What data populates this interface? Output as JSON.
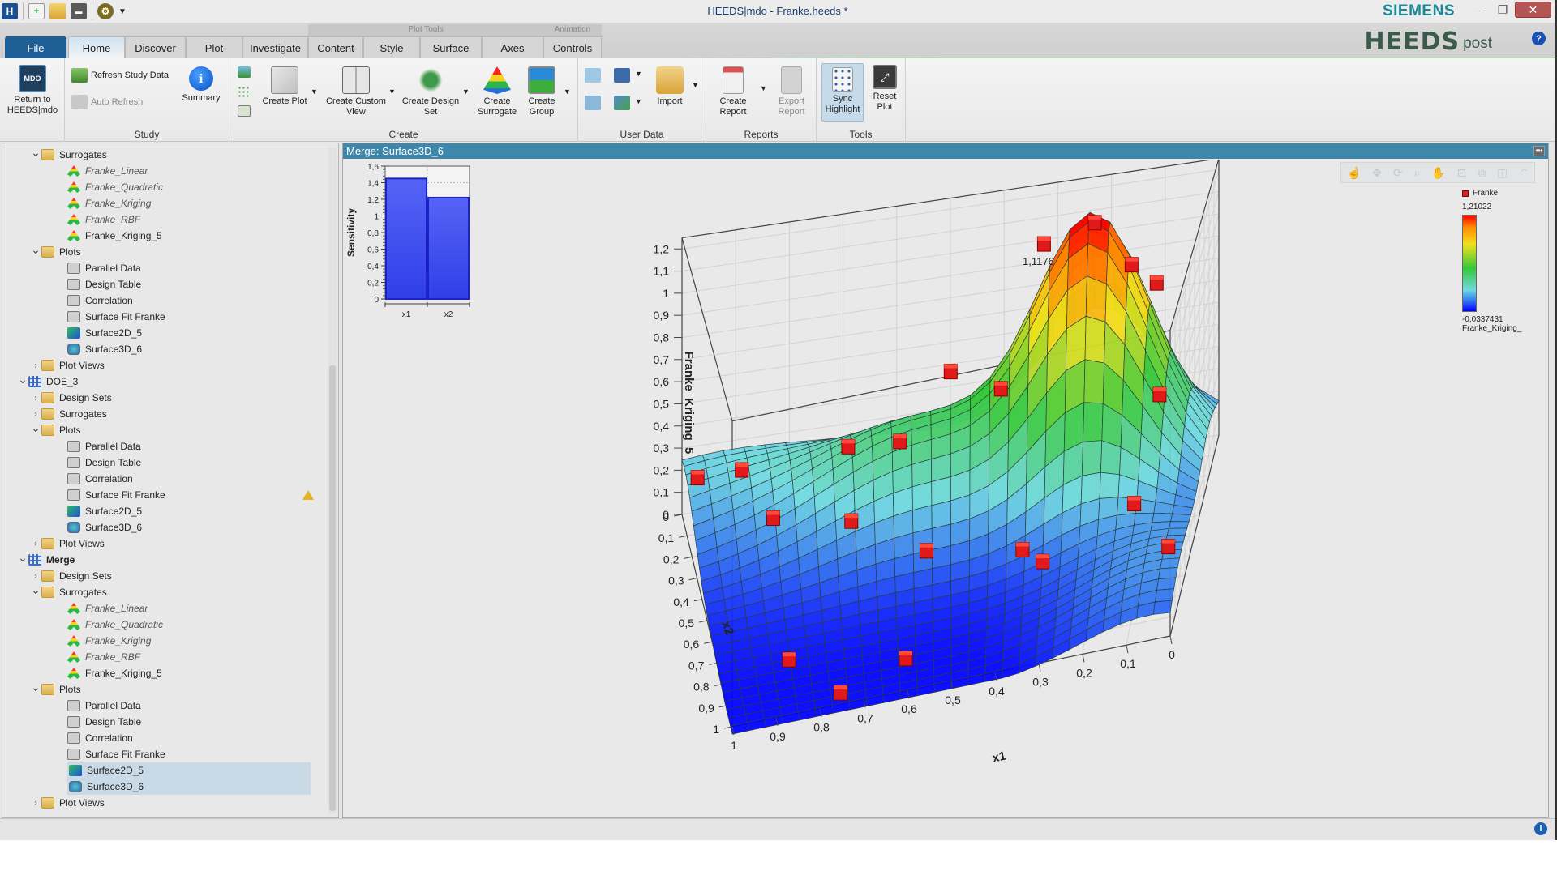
{
  "window": {
    "title": "HEEDS|mdo - Franke.heeds *",
    "vendor": "SIEMENS",
    "brand_main": "HEEDS",
    "brand_sub": "post",
    "controls": {
      "minimize": "—",
      "restore": "❐",
      "close": "✕"
    },
    "help": "?"
  },
  "quick_access": [
    {
      "name": "app-logo-icon",
      "glyph": "H"
    },
    {
      "name": "new-file-icon",
      "glyph": "🗋"
    },
    {
      "name": "open-folder-icon",
      "glyph": "📂"
    },
    {
      "name": "save-icon",
      "glyph": "💾"
    },
    {
      "name": "settings-icon",
      "glyph": "⚙"
    },
    {
      "name": "qat-dropdown-icon",
      "glyph": "▾"
    }
  ],
  "context_labels": {
    "plot_tools": "Plot Tools",
    "animation": "Animation"
  },
  "tabs": [
    {
      "label": "File"
    },
    {
      "label": "Home"
    },
    {
      "label": "Discover"
    },
    {
      "label": "Plot"
    },
    {
      "label": "Investigate"
    },
    {
      "label": "Content"
    },
    {
      "label": "Style"
    },
    {
      "label": "Surface"
    },
    {
      "label": "Axes"
    },
    {
      "label": "Controls"
    }
  ],
  "active_tab": "Home",
  "ribbon": {
    "groups": {
      "study": "Study",
      "create": "Create",
      "user_data": "User Data",
      "reports": "Reports",
      "tools": "Tools"
    },
    "return_to": "Return to HEEDS|mdo",
    "return_icon_text": "MDO",
    "refresh_study_data": "Refresh Study Data",
    "auto_refresh": "Auto Refresh",
    "summary": "Summary",
    "create_plot": "Create Plot",
    "create_custom_view": "Create Custom View",
    "create_design_set": "Create Design Set",
    "create_surrogate": "Create Surrogate",
    "create_group": "Create Group",
    "import": "Import",
    "create_report": "Create Report",
    "export_report": "Export Report",
    "sync_highlight": "Sync Highlight",
    "reset_plot": "Reset Plot"
  },
  "tree": [
    {
      "label": "Surrogates",
      "level": 1,
      "type": "folder",
      "expanded": true
    },
    {
      "label": "Franke_Linear",
      "level": 2,
      "type": "surrogate",
      "italic": true
    },
    {
      "label": "Franke_Quadratic",
      "level": 2,
      "type": "surrogate",
      "italic": true
    },
    {
      "label": "Franke_Kriging",
      "level": 2,
      "type": "surrogate",
      "italic": true
    },
    {
      "label": "Franke_RBF",
      "level": 2,
      "type": "surrogate",
      "italic": true
    },
    {
      "label": "Franke_Kriging_5",
      "level": 2,
      "type": "surrogate"
    },
    {
      "label": "Plots",
      "level": 1,
      "type": "folder",
      "expanded": true
    },
    {
      "label": "Parallel Data",
      "level": 2,
      "type": "plot"
    },
    {
      "label": "Design Table",
      "level": 2,
      "type": "plot"
    },
    {
      "label": "Correlation",
      "level": 2,
      "type": "plot"
    },
    {
      "label": "Surface Fit Franke",
      "level": 2,
      "type": "plot"
    },
    {
      "label": "Surface2D_5",
      "level": 2,
      "type": "s2d"
    },
    {
      "label": "Surface3D_6",
      "level": 2,
      "type": "s3d"
    },
    {
      "label": "Plot Views",
      "level": 1,
      "type": "folder",
      "expanded": false
    },
    {
      "label": "DOE_3",
      "level": 0,
      "type": "grid",
      "expanded": true
    },
    {
      "label": "Design Sets",
      "level": 1,
      "type": "folder",
      "expanded": false
    },
    {
      "label": "Surrogates",
      "level": 1,
      "type": "folder",
      "expanded": false
    },
    {
      "label": "Plots",
      "level": 1,
      "type": "folder",
      "expanded": true
    },
    {
      "label": "Parallel Data",
      "level": 2,
      "type": "plot"
    },
    {
      "label": "Design Table",
      "level": 2,
      "type": "plot"
    },
    {
      "label": "Correlation",
      "level": 2,
      "type": "plot"
    },
    {
      "label": "Surface Fit Franke",
      "level": 2,
      "type": "plot",
      "warning": true
    },
    {
      "label": "Surface2D_5",
      "level": 2,
      "type": "s2d"
    },
    {
      "label": "Surface3D_6",
      "level": 2,
      "type": "s3d"
    },
    {
      "label": "Plot Views",
      "level": 1,
      "type": "folder",
      "expanded": false
    },
    {
      "label": "Merge",
      "level": 0,
      "type": "grid",
      "expanded": true,
      "bold": true
    },
    {
      "label": "Design Sets",
      "level": 1,
      "type": "folder",
      "expanded": false
    },
    {
      "label": "Surrogates",
      "level": 1,
      "type": "folder",
      "expanded": true
    },
    {
      "label": "Franke_Linear",
      "level": 2,
      "type": "surrogate",
      "italic": true
    },
    {
      "label": "Franke_Quadratic",
      "level": 2,
      "type": "surrogate",
      "italic": true
    },
    {
      "label": "Franke_Kriging",
      "level": 2,
      "type": "surrogate",
      "italic": true
    },
    {
      "label": "Franke_RBF",
      "level": 2,
      "type": "surrogate",
      "italic": true
    },
    {
      "label": "Franke_Kriging_5",
      "level": 2,
      "type": "surrogate"
    },
    {
      "label": "Plots",
      "level": 1,
      "type": "folder",
      "expanded": true
    },
    {
      "label": "Parallel Data",
      "level": 2,
      "type": "plot"
    },
    {
      "label": "Design Table",
      "level": 2,
      "type": "plot"
    },
    {
      "label": "Correlation",
      "level": 2,
      "type": "plot"
    },
    {
      "label": "Surface Fit Franke",
      "level": 2,
      "type": "plot"
    },
    {
      "label": "Surface2D_5",
      "level": 2,
      "type": "s2d",
      "selected": true
    },
    {
      "label": "Surface3D_6",
      "level": 2,
      "type": "s3d",
      "selected": true
    },
    {
      "label": "Plot Views",
      "level": 1,
      "type": "folder",
      "expanded": false
    }
  ],
  "panel": {
    "title": "Merge: Surface3D_6",
    "menu": "•••"
  },
  "chart_data": [
    {
      "type": "bar",
      "title": "",
      "categories": [
        "x1",
        "x2"
      ],
      "values": [
        1.45,
        1.22
      ],
      "xlabel": "",
      "ylabel": "Sensitivity",
      "ylim": [
        0,
        1.6
      ],
      "yticks": [
        "0",
        "0,2",
        "0,4",
        "0,6",
        "0,8",
        "1",
        "1,2",
        "1,4",
        "1,6"
      ],
      "bar_color": "#3d4ff0",
      "grid": true
    },
    {
      "type": "surface3d",
      "title": "",
      "xlabel": "x1",
      "ylabel": "x2",
      "zlabel": "Franke_Kriging_5",
      "x_ticks": [
        "1",
        "0,9",
        "0,8",
        "0,7",
        "0,6",
        "0,5",
        "0,4",
        "0,3",
        "0,2",
        "0,1",
        "0"
      ],
      "y_ticks": [
        "0",
        "0,1",
        "0,2",
        "0,3",
        "0,4",
        "0,5",
        "0,6",
        "0,7",
        "0,8",
        "0,9",
        "1"
      ],
      "z_ticks": [
        "0",
        "0,1",
        "0,2",
        "0,3",
        "0,4",
        "0,5",
        "0,6",
        "0,7",
        "0,8",
        "0,9",
        "1",
        "1,1",
        "1,2"
      ],
      "xlim": [
        0,
        1
      ],
      "ylim": [
        0,
        1
      ],
      "zlim": [
        0,
        1.2
      ],
      "peak_label": "1,1176",
      "legend": {
        "series": "Franke",
        "series_color": "#d42020",
        "colorbar_max": "1,21022",
        "colorbar_min": "-0,0337431",
        "colorbar_label": "Franke_Kriging_"
      },
      "design_points": [
        {
          "x1": 0.22,
          "x2": 0.22,
          "z": 1.1
        },
        {
          "x1": 0.32,
          "x2": 0.18,
          "z": 1.12
        },
        {
          "x1": 0.15,
          "x2": 0.2,
          "z": 0.95
        },
        {
          "x1": 0.1,
          "x2": 0.22,
          "z": 0.9
        },
        {
          "x1": 0.5,
          "x2": 0.3,
          "z": 0.72
        },
        {
          "x1": 0.4,
          "x2": 0.35,
          "z": 0.65
        },
        {
          "x1": 0.08,
          "x2": 0.4,
          "z": 0.55
        },
        {
          "x1": 0.6,
          "x2": 0.3,
          "z": 0.45
        },
        {
          "x1": 0.7,
          "x2": 0.25,
          "z": 0.42
        },
        {
          "x1": 0.9,
          "x2": 0.15,
          "z": 0.3
        },
        {
          "x1": 0.98,
          "x2": 0.1,
          "z": 0.1
        },
        {
          "x1": 0.85,
          "x2": 0.3,
          "z": 0.1
        },
        {
          "x1": 0.7,
          "x2": 0.4,
          "z": 0.12
        },
        {
          "x1": 0.55,
          "x2": 0.5,
          "z": 0.12
        },
        {
          "x1": 0.35,
          "x2": 0.6,
          "z": 0.15
        },
        {
          "x1": 0.12,
          "x2": 0.55,
          "z": 0.2
        },
        {
          "x1": 0.3,
          "x2": 0.8,
          "z": 0.25
        },
        {
          "x1": 0.02,
          "x2": 0.85,
          "z": 0.25
        },
        {
          "x1": 0.85,
          "x2": 0.75,
          "z": 0.0
        },
        {
          "x1": 0.6,
          "x2": 0.85,
          "z": 0.0
        },
        {
          "x1": 0.75,
          "x2": 0.95,
          "z": 0.0
        }
      ]
    }
  ],
  "toolbar_icons": [
    "pointer-icon",
    "rotate-icon",
    "orbit-icon",
    "zoom-icon",
    "pan-icon",
    "view-icon",
    "copy-icon",
    "split-icon",
    "collapse-icon"
  ],
  "status": {
    "info": "i"
  }
}
